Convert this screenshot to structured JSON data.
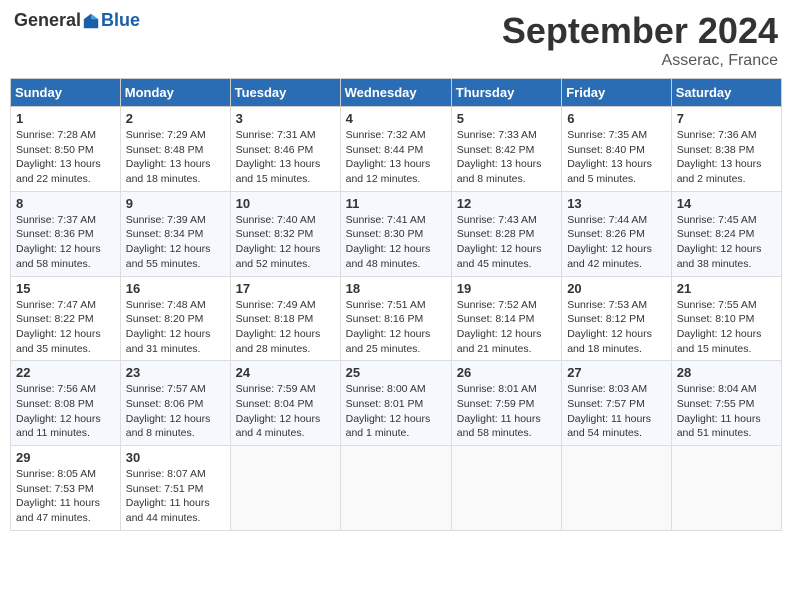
{
  "header": {
    "logo_general": "General",
    "logo_blue": "Blue",
    "month": "September 2024",
    "location": "Asserac, France"
  },
  "weekdays": [
    "Sunday",
    "Monday",
    "Tuesday",
    "Wednesday",
    "Thursday",
    "Friday",
    "Saturday"
  ],
  "weeks": [
    [
      {
        "day": "1",
        "info": "Sunrise: 7:28 AM\nSunset: 8:50 PM\nDaylight: 13 hours\nand 22 minutes."
      },
      {
        "day": "2",
        "info": "Sunrise: 7:29 AM\nSunset: 8:48 PM\nDaylight: 13 hours\nand 18 minutes."
      },
      {
        "day": "3",
        "info": "Sunrise: 7:31 AM\nSunset: 8:46 PM\nDaylight: 13 hours\nand 15 minutes."
      },
      {
        "day": "4",
        "info": "Sunrise: 7:32 AM\nSunset: 8:44 PM\nDaylight: 13 hours\nand 12 minutes."
      },
      {
        "day": "5",
        "info": "Sunrise: 7:33 AM\nSunset: 8:42 PM\nDaylight: 13 hours\nand 8 minutes."
      },
      {
        "day": "6",
        "info": "Sunrise: 7:35 AM\nSunset: 8:40 PM\nDaylight: 13 hours\nand 5 minutes."
      },
      {
        "day": "7",
        "info": "Sunrise: 7:36 AM\nSunset: 8:38 PM\nDaylight: 13 hours\nand 2 minutes."
      }
    ],
    [
      {
        "day": "8",
        "info": "Sunrise: 7:37 AM\nSunset: 8:36 PM\nDaylight: 12 hours\nand 58 minutes."
      },
      {
        "day": "9",
        "info": "Sunrise: 7:39 AM\nSunset: 8:34 PM\nDaylight: 12 hours\nand 55 minutes."
      },
      {
        "day": "10",
        "info": "Sunrise: 7:40 AM\nSunset: 8:32 PM\nDaylight: 12 hours\nand 52 minutes."
      },
      {
        "day": "11",
        "info": "Sunrise: 7:41 AM\nSunset: 8:30 PM\nDaylight: 12 hours\nand 48 minutes."
      },
      {
        "day": "12",
        "info": "Sunrise: 7:43 AM\nSunset: 8:28 PM\nDaylight: 12 hours\nand 45 minutes."
      },
      {
        "day": "13",
        "info": "Sunrise: 7:44 AM\nSunset: 8:26 PM\nDaylight: 12 hours\nand 42 minutes."
      },
      {
        "day": "14",
        "info": "Sunrise: 7:45 AM\nSunset: 8:24 PM\nDaylight: 12 hours\nand 38 minutes."
      }
    ],
    [
      {
        "day": "15",
        "info": "Sunrise: 7:47 AM\nSunset: 8:22 PM\nDaylight: 12 hours\nand 35 minutes."
      },
      {
        "day": "16",
        "info": "Sunrise: 7:48 AM\nSunset: 8:20 PM\nDaylight: 12 hours\nand 31 minutes."
      },
      {
        "day": "17",
        "info": "Sunrise: 7:49 AM\nSunset: 8:18 PM\nDaylight: 12 hours\nand 28 minutes."
      },
      {
        "day": "18",
        "info": "Sunrise: 7:51 AM\nSunset: 8:16 PM\nDaylight: 12 hours\nand 25 minutes."
      },
      {
        "day": "19",
        "info": "Sunrise: 7:52 AM\nSunset: 8:14 PM\nDaylight: 12 hours\nand 21 minutes."
      },
      {
        "day": "20",
        "info": "Sunrise: 7:53 AM\nSunset: 8:12 PM\nDaylight: 12 hours\nand 18 minutes."
      },
      {
        "day": "21",
        "info": "Sunrise: 7:55 AM\nSunset: 8:10 PM\nDaylight: 12 hours\nand 15 minutes."
      }
    ],
    [
      {
        "day": "22",
        "info": "Sunrise: 7:56 AM\nSunset: 8:08 PM\nDaylight: 12 hours\nand 11 minutes."
      },
      {
        "day": "23",
        "info": "Sunrise: 7:57 AM\nSunset: 8:06 PM\nDaylight: 12 hours\nand 8 minutes."
      },
      {
        "day": "24",
        "info": "Sunrise: 7:59 AM\nSunset: 8:04 PM\nDaylight: 12 hours\nand 4 minutes."
      },
      {
        "day": "25",
        "info": "Sunrise: 8:00 AM\nSunset: 8:01 PM\nDaylight: 12 hours\nand 1 minute."
      },
      {
        "day": "26",
        "info": "Sunrise: 8:01 AM\nSunset: 7:59 PM\nDaylight: 11 hours\nand 58 minutes."
      },
      {
        "day": "27",
        "info": "Sunrise: 8:03 AM\nSunset: 7:57 PM\nDaylight: 11 hours\nand 54 minutes."
      },
      {
        "day": "28",
        "info": "Sunrise: 8:04 AM\nSunset: 7:55 PM\nDaylight: 11 hours\nand 51 minutes."
      }
    ],
    [
      {
        "day": "29",
        "info": "Sunrise: 8:05 AM\nSunset: 7:53 PM\nDaylight: 11 hours\nand 47 minutes."
      },
      {
        "day": "30",
        "info": "Sunrise: 8:07 AM\nSunset: 7:51 PM\nDaylight: 11 hours\nand 44 minutes."
      },
      {
        "day": "",
        "info": ""
      },
      {
        "day": "",
        "info": ""
      },
      {
        "day": "",
        "info": ""
      },
      {
        "day": "",
        "info": ""
      },
      {
        "day": "",
        "info": ""
      }
    ]
  ]
}
